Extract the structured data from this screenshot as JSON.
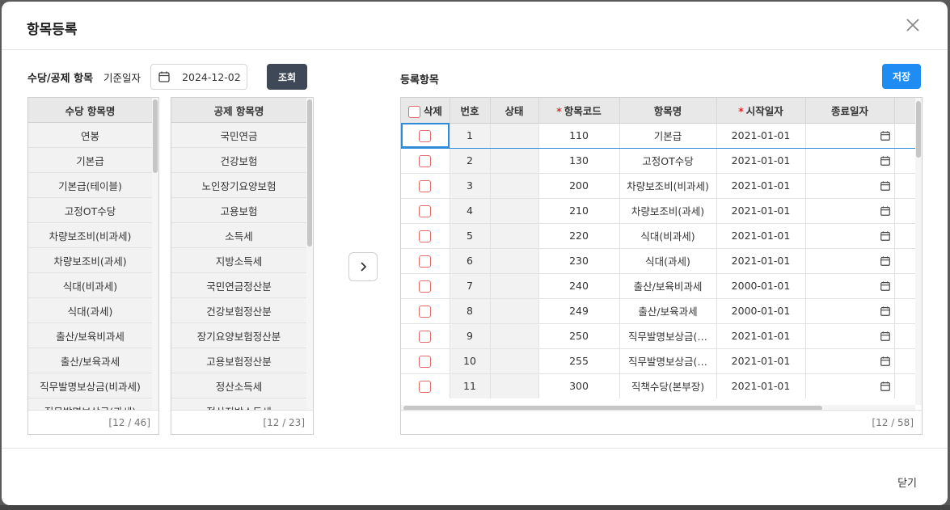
{
  "dialog": {
    "title": "항목등록",
    "close_label": "닫기"
  },
  "left_toolbar": {
    "section_title": "수당/공제 항목",
    "base_date_label": "기준일자",
    "base_date_value": "2024-12-02",
    "search_button": "조회"
  },
  "allowance_list": {
    "header": "수당 항목명",
    "items": [
      "연봉",
      "기본급",
      "기본급(테이블)",
      "고정OT수당",
      "차량보조비(비과세)",
      "차량보조비(과세)",
      "식대(비과세)",
      "식대(과세)",
      "출산/보육비과세",
      "출산/보육과세",
      "직무발명보상금(비과세)",
      "직무발명보상금(과세)"
    ],
    "count": "[12 / 46]",
    "scroll_fraction_top": 0.0,
    "scroll_fraction_visible": 0.26
  },
  "deduction_list": {
    "header": "공제 항목명",
    "items": [
      "국민연금",
      "건강보험",
      "노인장기요양보험",
      "고용보험",
      "소득세",
      "지방소득세",
      "국민연금정산분",
      "건강보험정산분",
      "장기요양보험정산분",
      "고용보험정산분",
      "정산소득세",
      "정산지방소득세"
    ],
    "count": "[12 / 23]",
    "scroll_fraction_top": 0.0,
    "scroll_fraction_visible": 0.52
  },
  "registered": {
    "title": "등록항목",
    "save_button": "저장",
    "columns": {
      "delete": "삭제",
      "no": "번호",
      "status": "상태",
      "code": "항목코드",
      "name": "항목명",
      "start": "시작일자",
      "end": "종료일자"
    },
    "rows": [
      {
        "no": "1",
        "code": "110",
        "name": "기본급",
        "start": "2021-01-01"
      },
      {
        "no": "2",
        "code": "130",
        "name": "고정OT수당",
        "start": "2021-01-01"
      },
      {
        "no": "3",
        "code": "200",
        "name": "차량보조비(비과세)",
        "start": "2021-01-01"
      },
      {
        "no": "4",
        "code": "210",
        "name": "차량보조비(과세)",
        "start": "2021-01-01"
      },
      {
        "no": "5",
        "code": "220",
        "name": "식대(비과세)",
        "start": "2021-01-01"
      },
      {
        "no": "6",
        "code": "230",
        "name": "식대(과세)",
        "start": "2021-01-01"
      },
      {
        "no": "7",
        "code": "240",
        "name": "출산/보육비과세",
        "start": "2000-01-01"
      },
      {
        "no": "8",
        "code": "249",
        "name": "출산/보육과세",
        "start": "2000-01-01"
      },
      {
        "no": "9",
        "code": "250",
        "name": "직무발명보상금(…",
        "start": "2021-01-01"
      },
      {
        "no": "10",
        "code": "255",
        "name": "직무발명보상금(…",
        "start": "2021-01-01"
      },
      {
        "no": "11",
        "code": "300",
        "name": "직책수당(본부장)",
        "start": "2021-01-01"
      }
    ],
    "count": "[12 / 58]"
  },
  "icons": {
    "close": "close-icon",
    "calendar": "calendar-icon",
    "move": "chevron-right-icon"
  },
  "colors": {
    "primary": "#1e8cf2",
    "dark_button": "#3f4857",
    "checkbox_border": "#e06b6b",
    "required": "#e03131",
    "selection": "#2d8bd9"
  }
}
